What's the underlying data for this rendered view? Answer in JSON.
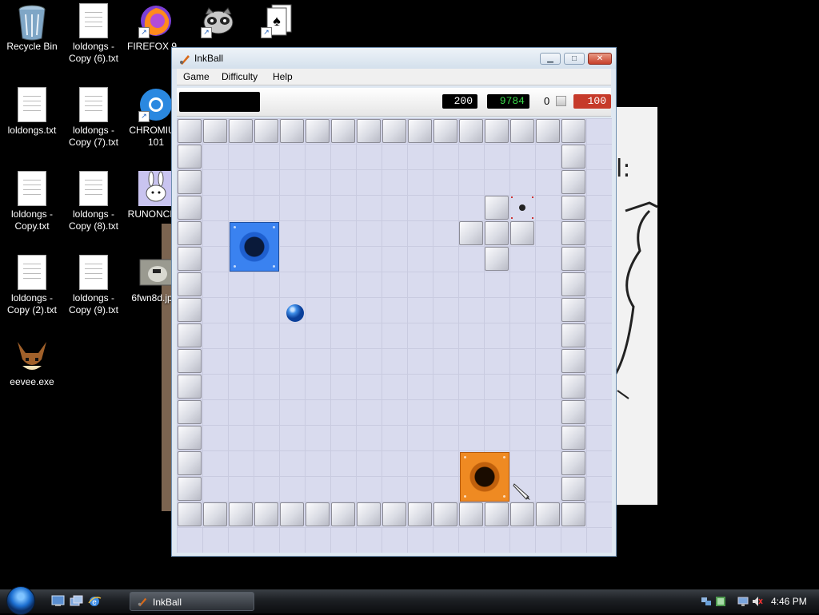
{
  "desktop": {
    "icons": [
      {
        "label": "Recycle Bin"
      },
      {
        "label": "loldongs - Copy (6).txt"
      },
      {
        "label": "FIREFOX 9..."
      },
      {
        "label": "loldongs.txt"
      },
      {
        "label": "loldongs - Copy (7).txt"
      },
      {
        "label": "CHROMIU... 101"
      },
      {
        "label": "loldongs - Copy.txt"
      },
      {
        "label": "loldongs - Copy (8).txt"
      },
      {
        "label": "RUNONCE..."
      },
      {
        "label": "loldongs - Copy (2).txt"
      },
      {
        "label": "loldongs - Copy (9).txt"
      },
      {
        "label": "6fwn8d.jp..."
      },
      {
        "label": "eevee.exe"
      }
    ],
    "background_partial_text": "l:"
  },
  "window": {
    "title": "InkBall",
    "menu": [
      "Game",
      "Difficulty",
      "Help"
    ],
    "status": {
      "message": "",
      "score_1": "200",
      "score_2": "9784",
      "balls": "0",
      "timer": "100"
    },
    "board": {
      "grid": [
        16,
        16
      ],
      "colors": {
        "floor": "#d9dbee",
        "blue_hole": "#3a82f0",
        "orange_hole": "#ef8a22",
        "ball": "#1e6fd8"
      }
    }
  },
  "taskbar": {
    "task_label": "InkBall",
    "clock": "4:46 PM"
  }
}
